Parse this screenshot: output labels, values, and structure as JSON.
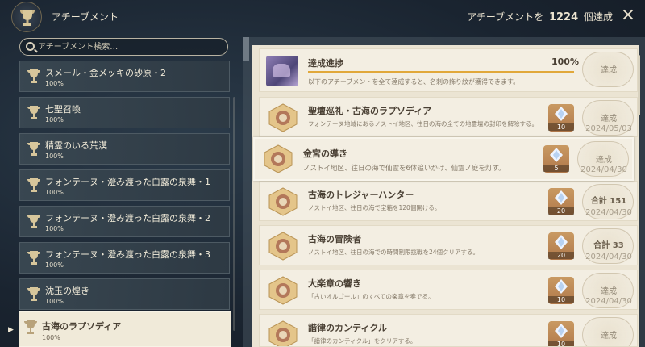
{
  "header": {
    "title": "アチーブメント",
    "progress_prefix": "アチーブメントを",
    "progress_count": "1224",
    "progress_suffix": "個達成"
  },
  "search": {
    "placeholder": "アチーブメント検索…"
  },
  "categories": [
    {
      "name": "スメール・金メッキの砂原・2",
      "pct": "100%"
    },
    {
      "name": "七聖召喚",
      "pct": "100%"
    },
    {
      "name": "精霊のいる荒漠",
      "pct": "100%"
    },
    {
      "name": "フォンテーヌ・澄み渡った白露の泉舞・1",
      "pct": "100%"
    },
    {
      "name": "フォンテーヌ・澄み渡った白露の泉舞・2",
      "pct": "100%"
    },
    {
      "name": "フォンテーヌ・澄み渡った白露の泉舞・3",
      "pct": "100%"
    },
    {
      "name": "沈玉の煌き",
      "pct": "100%"
    },
    {
      "name": "古海のラプソディア",
      "pct": "100%"
    }
  ],
  "progress_card": {
    "title": "達成進捗",
    "percent_label": "100%",
    "percent_value": 100,
    "description": "以下のアチーブメントを全て達成すると、名刺の飾り紋が獲得できます。",
    "stamp": "達成"
  },
  "achievements": [
    {
      "title": "聖壇巡礼・古海のラプソディア",
      "desc": "フォンテーヌ地域にあるノストイ地区、往日の海の全ての地霊壇の封印を解除する。",
      "reward": "10",
      "status": "達成",
      "date": "2024/05/03"
    },
    {
      "title": "金宮の導き",
      "desc": "ノストイ地区、往日の海で仙霊を6体追いかけ、仙霊ノ庭を灯す。",
      "reward": "5",
      "status": "達成",
      "date": "2024/04/30"
    },
    {
      "title": "古海のトレジャーハンター",
      "desc": "ノストイ地区、往日の海で宝箱を120個開ける。",
      "reward": "20",
      "status": "合計 151",
      "date": "2024/04/30"
    },
    {
      "title": "古海の冒険者",
      "desc": "ノストイ地区、往日の海での時間制限挑戦を24個クリアする。",
      "reward": "20",
      "status": "合計 33",
      "date": "2024/04/30"
    },
    {
      "title": "大楽章の響き",
      "desc": "「古いオルゴール」のすべての楽章を奏でる。",
      "reward": "10",
      "status": "達成",
      "date": "2024/04/30"
    },
    {
      "title": "諧律のカンティクル",
      "desc": "「諧律のカンティクル」をクリアする。",
      "reward": "10",
      "status": "達成",
      "date": ""
    }
  ],
  "colors": {
    "accent": "#e1a83a",
    "panel": "#ebe4d3",
    "card": "#f3eee2",
    "reward": "#b0784a"
  }
}
